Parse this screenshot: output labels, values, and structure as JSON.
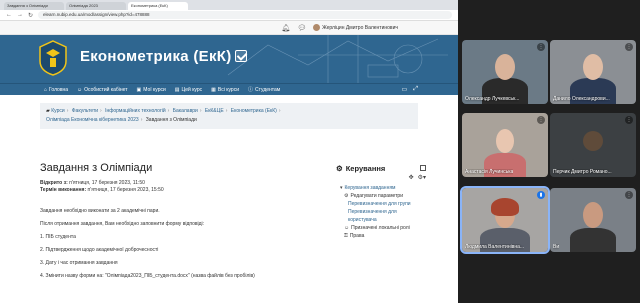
{
  "browser": {
    "tabs": [
      "Завдання з Олімпіади",
      "Олімпіада 2023",
      "Економетрика (ЕкК)"
    ],
    "url": "elearn.nubip.edu.ua/mod/assign/view.php?id=478888"
  },
  "topbar": {
    "user_name": "Жерліцин Дмитро Валентинович"
  },
  "banner": {
    "title": "Економетрика (ЕкК)"
  },
  "navbar": {
    "items": [
      "Головна",
      "Особистий кабінет",
      "Мої курси",
      "Цей курс",
      "Всі курси",
      "Студентам"
    ]
  },
  "breadcrumb": {
    "items": [
      "Курси",
      "Факультети",
      "Інформаційних технологій",
      "Бакалаври",
      "ЕкК&ЦЕ",
      "Економетрика (ЕкК)",
      "Олімпіада Економічна кібернетика 2023",
      "Завдання з Олімпіади"
    ]
  },
  "main": {
    "heading": "Завдання з Олімпіади",
    "opened_label": "Відкрито з:",
    "opened_value": "п'ятниця, 17 березня 2023, 11:50",
    "due_label": "Термін виконання:",
    "due_value": "п'ятниця, 17 березня 2023, 15:50",
    "paragraphs": [
      "Завдання необхідно виконати за 2 академічні пари.",
      "Після отримання завдання, Вам необхідно заповнити форму відповіді:",
      "1. ПІБ студента",
      "2. Підтвердження щодо академічної доброчесності",
      "3. Дату і час отримання завдання",
      "4. Змінити назву форми на: \"Олімпіада2023_ПІБ_студента.docx\" (назва файлів без пробілів)"
    ]
  },
  "admin": {
    "title": "Керування",
    "items": [
      {
        "label": "Керування завданням",
        "level": "lvl0"
      },
      {
        "label": "Редагувати параметри",
        "level": "lvl1"
      },
      {
        "label": "Перевизначення для групи",
        "level": "lvl2"
      },
      {
        "label": "Перевизначення для користувача",
        "level": "lvl2"
      },
      {
        "label": "Призначені локальні ролі",
        "level": "lvl1"
      },
      {
        "label": "Права",
        "level": "lvl1"
      }
    ]
  },
  "participants": [
    {
      "name": "Олександр Лучкевськ..."
    },
    {
      "name": "Данило Олександрови..."
    },
    {
      "name": "Анастасія Лучинська"
    },
    {
      "name": "Перчик Дмитро Романо..."
    },
    {
      "name": "Людмила Валентинівна..."
    },
    {
      "name": "Ви"
    }
  ],
  "colors": {
    "brand": "#2f6690",
    "link": "#2f6690",
    "speaking_outline": "#8ab4f8"
  }
}
